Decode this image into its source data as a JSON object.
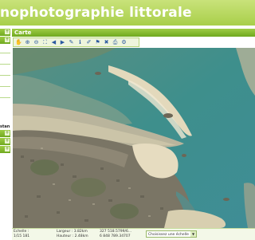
{
  "header": {
    "title": "nophotographie littorale"
  },
  "left_panel": {
    "fragment_text": "stan",
    "toggle_glyph": "+"
  },
  "map_panel": {
    "title": "Carte",
    "tools": [
      {
        "name": "pan-icon",
        "glyph": "✋"
      },
      {
        "name": "zoom-in-icon",
        "glyph": "⊕"
      },
      {
        "name": "zoom-out-icon",
        "glyph": "⊖"
      },
      {
        "name": "zoom-extent-icon",
        "glyph": "⛶"
      },
      {
        "name": "previous-view-icon",
        "glyph": "◀"
      },
      {
        "name": "next-view-icon",
        "glyph": "▶"
      },
      {
        "name": "measure-icon",
        "glyph": "✎"
      },
      {
        "name": "info-icon",
        "glyph": "ℹ"
      },
      {
        "name": "draw-icon",
        "glyph": "✐"
      },
      {
        "name": "flag-icon",
        "glyph": "⚑"
      },
      {
        "name": "delete-icon",
        "glyph": "✖"
      },
      {
        "name": "print-icon",
        "glyph": "⎙"
      },
      {
        "name": "settings-icon",
        "glyph": "⚙"
      }
    ]
  },
  "status_bar": {
    "scale_label": "Echelle :",
    "scale_value": "1/15 181",
    "width_label": "Largeur : 3.82km",
    "height_label": "Hauteur : 2.48km",
    "coord_x": "327 518.5799/6...",
    "coord_y": "6 848 789.34707",
    "scale_select_value": "Choisissez une échelle"
  },
  "colors": {
    "header_green": "#a8cf4a",
    "bar_green": "#6fa91f",
    "sea": "#3e8f8c",
    "sand": "#d8d1b4",
    "urban": "#7a7565"
  }
}
